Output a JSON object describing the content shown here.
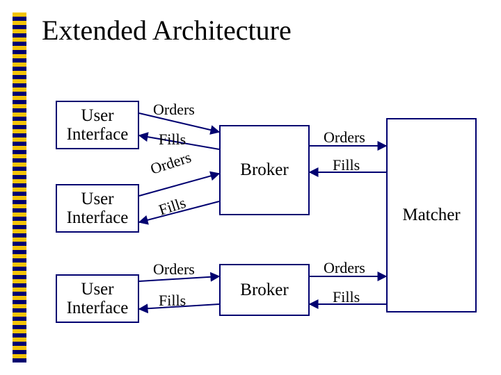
{
  "title": "Extended Architecture",
  "nodes": {
    "ui1": "User Interface",
    "ui2": "User Interface",
    "ui3": "User Interface",
    "broker1": "Broker",
    "broker2": "Broker",
    "matcher": "Matcher"
  },
  "edges": {
    "ui1_broker1": {
      "top": "Orders",
      "bottom": "Fills"
    },
    "ui2_broker1": {
      "top": "Orders",
      "bottom": "Fills"
    },
    "ui3_broker2": {
      "top": "Orders",
      "bottom": "Fills"
    },
    "broker1_matcher": {
      "top": "Orders",
      "bottom": "Fills"
    },
    "broker2_matcher": {
      "top": "Orders",
      "bottom": "Fills"
    }
  }
}
